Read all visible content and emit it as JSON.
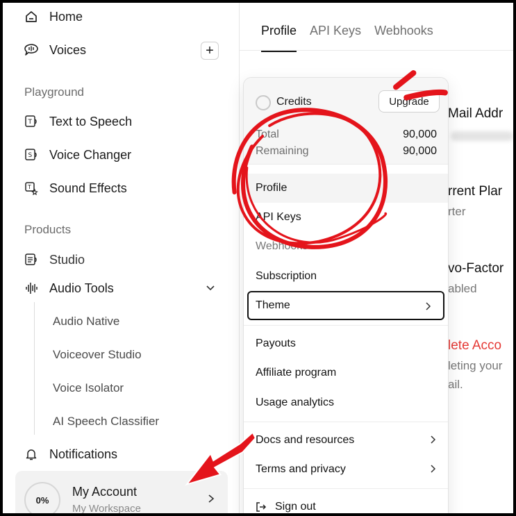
{
  "sidebar": {
    "items": [
      {
        "label": "Home",
        "icon": "home-icon"
      },
      {
        "label": "Voices",
        "icon": "voices-icon",
        "action": "+"
      }
    ],
    "playground": {
      "heading": "Playground",
      "items": [
        {
          "label": "Text to Speech",
          "icon": "text-to-speech-icon"
        },
        {
          "label": "Voice Changer",
          "icon": "voice-changer-icon"
        },
        {
          "label": "Sound Effects",
          "icon": "sound-effects-icon"
        }
      ]
    },
    "products": {
      "heading": "Products",
      "items": [
        {
          "label": "Studio",
          "icon": "studio-icon"
        },
        {
          "label": "Audio Tools",
          "icon": "audio-tools-icon"
        }
      ],
      "audio_tools_sub": [
        "Audio Native",
        "Voiceover Studio",
        "Voice Isolator",
        "AI Speech Classifier"
      ]
    },
    "notifications": "Notifications",
    "account": {
      "percent": "0%",
      "title": "My Account",
      "workspace": "My Workspace"
    }
  },
  "main": {
    "tabs": [
      {
        "label": "Profile"
      },
      {
        "label": "API Keys"
      },
      {
        "label": "Webhooks"
      }
    ],
    "background": {
      "email": "Mail Addr",
      "plan": "rrent Plar",
      "plan_value": "rter",
      "twofactor": "vo-Factor",
      "twofactor_value": "abled",
      "delete": "lete Acco",
      "delete_desc1": "leting your",
      "delete_desc2": "ail."
    }
  },
  "menu": {
    "credits": {
      "label": "Credits",
      "upgrade": "Upgrade",
      "total_label": "Total",
      "total_value": "90,000",
      "remaining_label": "Remaining",
      "remaining_value": "90,000"
    },
    "items": [
      "Profile",
      "API Keys",
      "Webhooks",
      "Subscription",
      "Theme",
      "Payouts",
      "Affiliate program",
      "Usage analytics",
      "Docs and resources",
      "Terms and privacy",
      "Sign out"
    ]
  },
  "colors": {
    "annotation_red": "#e4141b",
    "delete_red": "#e53935"
  }
}
